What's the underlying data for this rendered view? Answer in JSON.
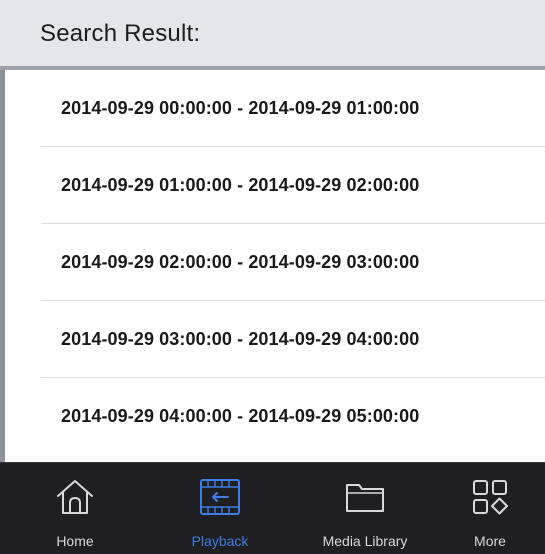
{
  "header": {
    "title": "Search Result:"
  },
  "results": [
    {
      "range": "2014-09-29 00:00:00 - 2014-09-29 01:00:00"
    },
    {
      "range": "2014-09-29 01:00:00 - 2014-09-29 02:00:00"
    },
    {
      "range": "2014-09-29 02:00:00 - 2014-09-29 03:00:00"
    },
    {
      "range": "2014-09-29 03:00:00 - 2014-09-29 04:00:00"
    },
    {
      "range": "2014-09-29 04:00:00 - 2014-09-29 05:00:00"
    }
  ],
  "tabbar": {
    "tabs": [
      {
        "label": "Home",
        "icon": "home-icon",
        "active": false
      },
      {
        "label": "Playback",
        "icon": "playback-film-icon",
        "active": true
      },
      {
        "label": "Media Library",
        "icon": "folder-icon",
        "active": false
      },
      {
        "label": "More",
        "icon": "grid-more-icon",
        "active": false
      }
    ]
  },
  "colors": {
    "header_bg": "#e4e6ec",
    "tabbar_bg": "#1f1f22",
    "active_tab": "#3d7fe6",
    "inactive_tab": "#d9d9dc"
  }
}
